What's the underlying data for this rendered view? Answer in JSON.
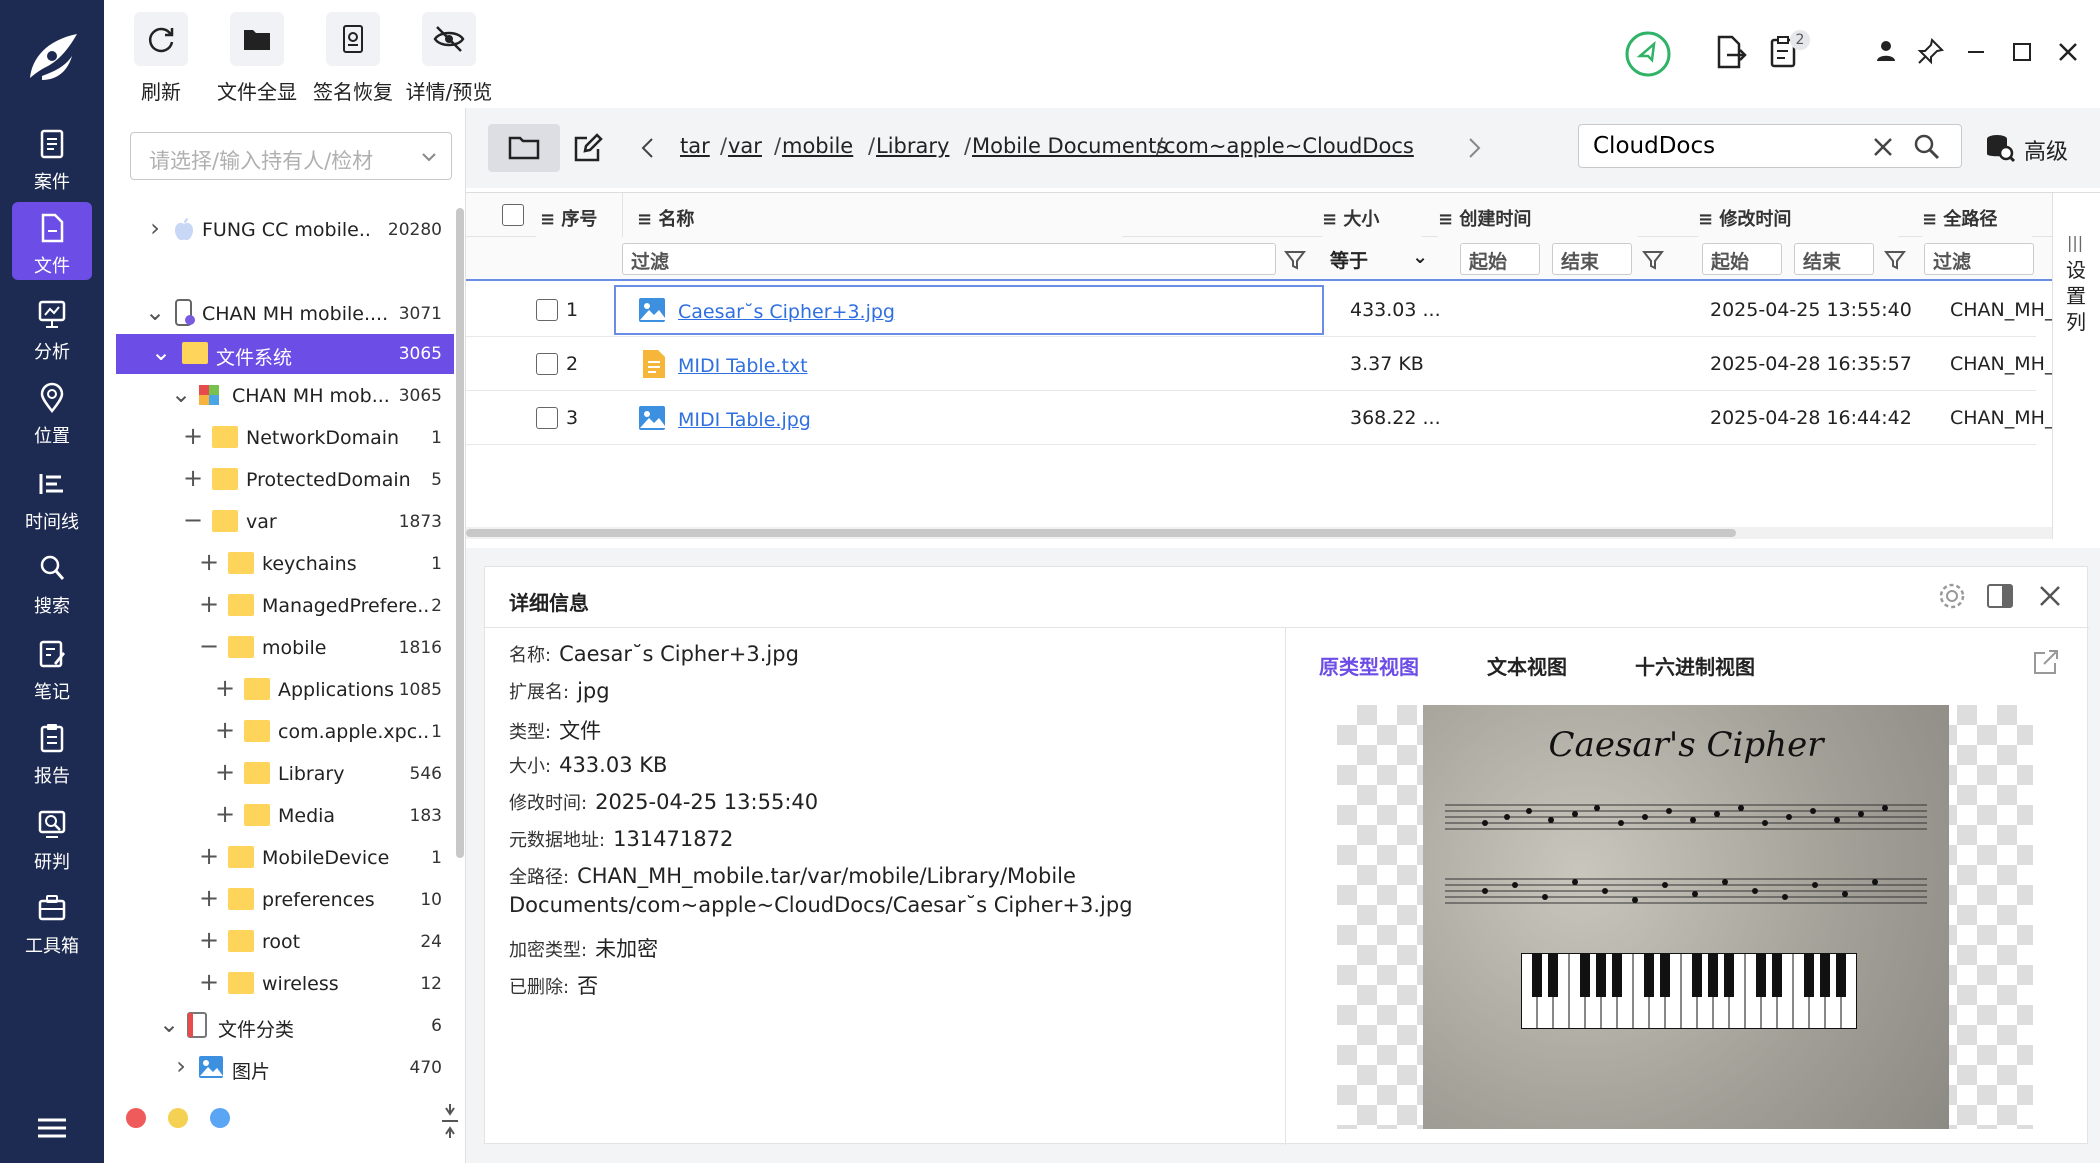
{
  "sidebar": {
    "items": [
      {
        "label": "案件",
        "icon": "case-icon"
      },
      {
        "label": "文件",
        "icon": "file-icon"
      },
      {
        "label": "分析",
        "icon": "analysis-icon"
      },
      {
        "label": "位置",
        "icon": "location-icon"
      },
      {
        "label": "时间线",
        "icon": "timeline-icon"
      },
      {
        "label": "搜索",
        "icon": "search-icon"
      },
      {
        "label": "笔记",
        "icon": "note-icon"
      },
      {
        "label": "报告",
        "icon": "report-icon"
      },
      {
        "label": "研判",
        "icon": "judge-icon"
      },
      {
        "label": "工具箱",
        "icon": "toolbox-icon"
      }
    ],
    "active_index": 1
  },
  "toolbar": {
    "refresh": "刷新",
    "show_all": "文件全显",
    "sig_restore": "签名恢复",
    "detail_preview": "详情/预览",
    "badge_count": "2"
  },
  "tree": {
    "owner_placeholder": "请选择/输入持有人/检材",
    "rows": [
      {
        "name": "FUNG CC mobile....",
        "count": "20280"
      },
      {
        "name": "CHAN MH mobile....",
        "count": "3071"
      },
      {
        "name": "文件系统",
        "count": "3065"
      },
      {
        "name": "CHAN MH mob...",
        "count": "3065"
      },
      {
        "name": "NetworkDomain",
        "count": "1"
      },
      {
        "name": "ProtectedDomain",
        "count": "5"
      },
      {
        "name": "var",
        "count": "1873"
      },
      {
        "name": "keychains",
        "count": "1"
      },
      {
        "name": "ManagedPrefere...",
        "count": "2"
      },
      {
        "name": "mobile",
        "count": "1816"
      },
      {
        "name": "Applications",
        "count": "1085"
      },
      {
        "name": "com.apple.xpc....",
        "count": "1"
      },
      {
        "name": "Library",
        "count": "546"
      },
      {
        "name": "Media",
        "count": "183"
      },
      {
        "name": "MobileDevice",
        "count": "1"
      },
      {
        "name": "preferences",
        "count": "10"
      },
      {
        "name": "root",
        "count": "24"
      },
      {
        "name": "wireless",
        "count": "12"
      },
      {
        "name": "文件分类",
        "count": "6"
      },
      {
        "name": "图片",
        "count": "470"
      }
    ]
  },
  "path": {
    "crumbs": [
      "tar",
      "var",
      "mobile",
      "Library",
      "Mobile Documents",
      "com~apple~CloudDocs"
    ],
    "sep": "/"
  },
  "search": {
    "value": "CloudDocs",
    "advanced": "高级"
  },
  "grid": {
    "headers": {
      "index": "序号",
      "name": "名称",
      "size": "大小",
      "created": "创建时间",
      "modified": "修改时间",
      "fullpath": "全路径"
    },
    "filters": {
      "name": "过滤",
      "size_op": "等于",
      "start1": "起始",
      "end1": "结束",
      "start2": "起始",
      "end2": "结束",
      "path": "过滤"
    },
    "settings_cols": "设置列",
    "rows": [
      {
        "index": "1",
        "name": "Caesar˘s Cipher+3.jpg",
        "size": "433.03 ...",
        "created": "",
        "modified": "2025-04-25 13:55:40",
        "path": "CHAN_MH_",
        "type": "image"
      },
      {
        "index": "2",
        "name": "MIDI Table.txt",
        "size": "3.37 KB",
        "created": "",
        "modified": "2025-04-28 16:35:57",
        "path": "CHAN_MH_",
        "type": "text"
      },
      {
        "index": "3",
        "name": "MIDI Table.jpg",
        "size": "368.22 ...",
        "created": "",
        "modified": "2025-04-28 16:44:42",
        "path": "CHAN_MH_",
        "type": "image"
      }
    ]
  },
  "detail": {
    "title": "详细信息",
    "fields": [
      {
        "k": "名称:",
        "v": "Caesar˘s Cipher+3.jpg"
      },
      {
        "k": "扩展名:",
        "v": "jpg"
      },
      {
        "k": "类型:",
        "v": "文件"
      },
      {
        "k": "大小:",
        "v": "433.03 KB"
      },
      {
        "k": "修改时间:",
        "v": "2025-04-25 13:55:40"
      },
      {
        "k": "元数据地址:",
        "v": "131471872"
      },
      {
        "k": "全路径:",
        "v": "CHAN_MH_mobile.tar/var/mobile/Library/Mobile"
      },
      {
        "k": "加密类型:",
        "v": "未加密"
      },
      {
        "k": "已删除:",
        "v": "否"
      }
    ],
    "fullpath_line2": "Documents/com~apple~CloudDocs/Caesar˘s Cipher+3.jpg",
    "tabs": [
      "原类型视图",
      "文本视图",
      "十六进制视图"
    ],
    "preview_title": "Caesar's Cipher"
  },
  "colors": {
    "sidebar": "#1d2a52",
    "accent": "#6c4ee6",
    "link": "#2f6fe0",
    "ok_green": "#2fb366"
  }
}
